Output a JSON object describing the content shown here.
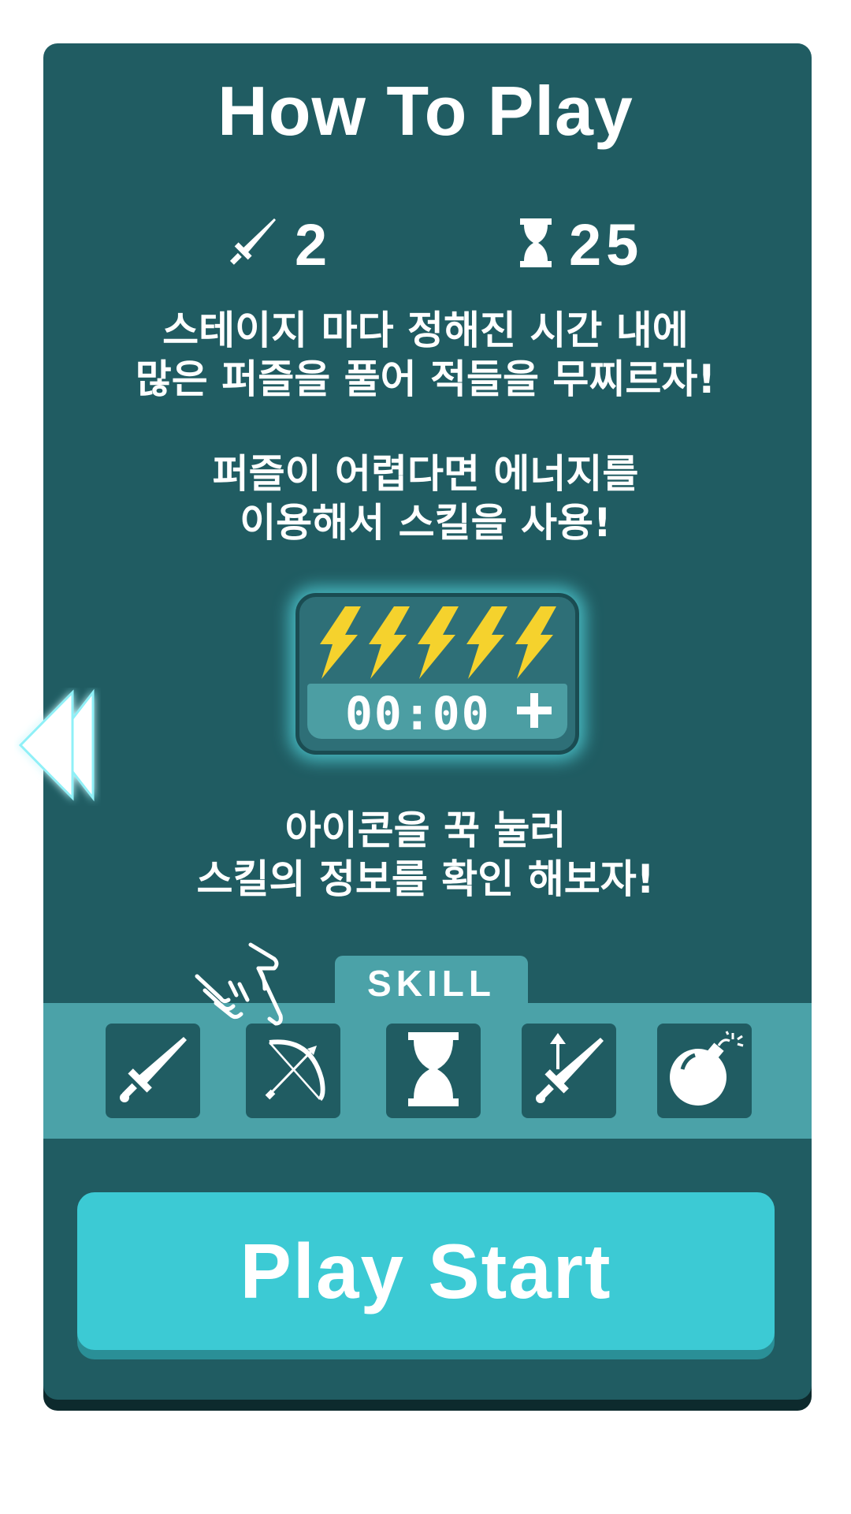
{
  "title": "How To Play",
  "stats": {
    "attack_icon": "sword-icon",
    "attack_value": "2",
    "time_icon": "hourglass-icon",
    "time_value": "25"
  },
  "instructions": {
    "line1": "스테이지 마다 정해진 시간 내에",
    "line2": "많은 퍼즐을 풀어 적들을 무찌르자!",
    "line3": "퍼즐이 어렵다면 에너지를",
    "line4": "이용해서 스킬을 사용!",
    "line5": "아이콘을 꾹 눌러",
    "line6": "스킬의 정보를 확인 해보자!"
  },
  "energy": {
    "bolt_count": 5,
    "bolt_color": "#f5d22d",
    "timer": "00:00",
    "add_icon": "plus-icon"
  },
  "skill": {
    "tab_label": "SKILL",
    "icons": [
      "sword-icon",
      "bow-icon",
      "hourglass-icon",
      "sword-up-icon",
      "bomb-icon"
    ]
  },
  "play_button": {
    "label": "Play Start"
  },
  "colors": {
    "panel": "#205c62",
    "accent": "#3ccad4",
    "skill_bar": "#4ba2a8"
  }
}
